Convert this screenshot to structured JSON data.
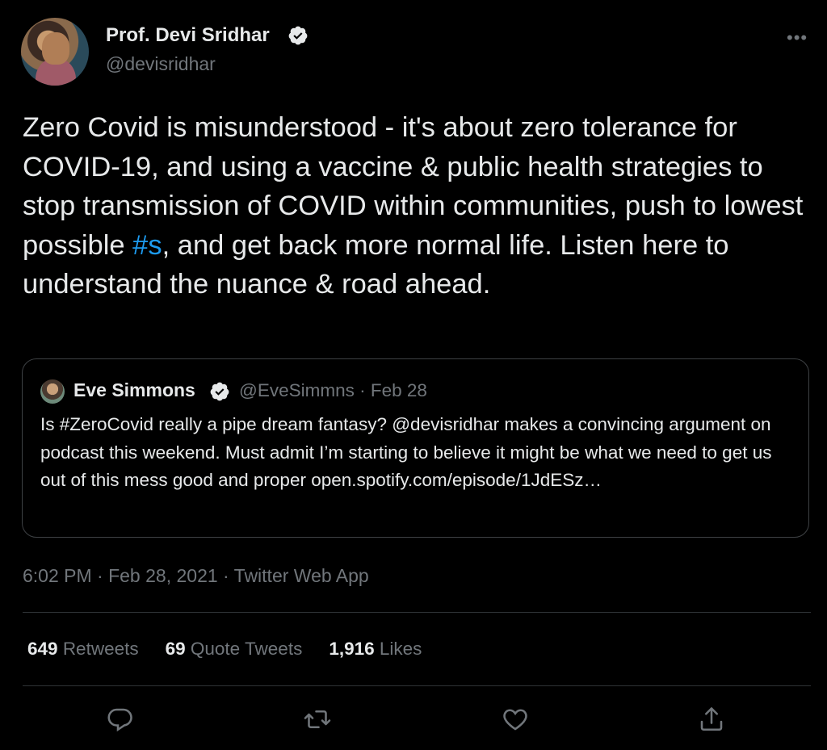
{
  "author": {
    "name": "Prof. Devi Sridhar",
    "handle": "@devisridhar",
    "verified": true
  },
  "tweet": {
    "text_before": "Zero Covid is misunderstood - it's about zero tolerance for COVID-19, and using a vaccine & public health strategies to stop transmission of COVID within communities, push to lowest possible ",
    "hashtag": "#s",
    "text_after": ", and get back more normal life. Listen here to understand the nuance & road ahead."
  },
  "quoted_tweet": {
    "name": "Eve Simmons",
    "handle_date": "@EveSimmns · Feb 28",
    "text": "Is #ZeroCovid really a pipe dream fantasy? @devisridhar makes a convincing argument on podcast this weekend. Must admit I’m starting to believe it might be what we need to get us out of this mess good and proper open.spotify.com/episode/1JdESz…"
  },
  "meta": "6:02 PM · Feb 28, 2021 · Twitter Web App",
  "stats": {
    "retweets_count": "649",
    "retweets_label": "Retweets",
    "quotes_count": "69",
    "quotes_label": "Quote Tweets",
    "likes_count": "1,916",
    "likes_label": "Likes"
  },
  "actions": [
    "reply-icon",
    "retweet-icon",
    "like-icon",
    "share-icon"
  ],
  "colors": {
    "background": "#000000",
    "text": "#e7e9ea",
    "muted": "#71767b",
    "link": "#1d9bf0",
    "border": "#2f3336"
  }
}
